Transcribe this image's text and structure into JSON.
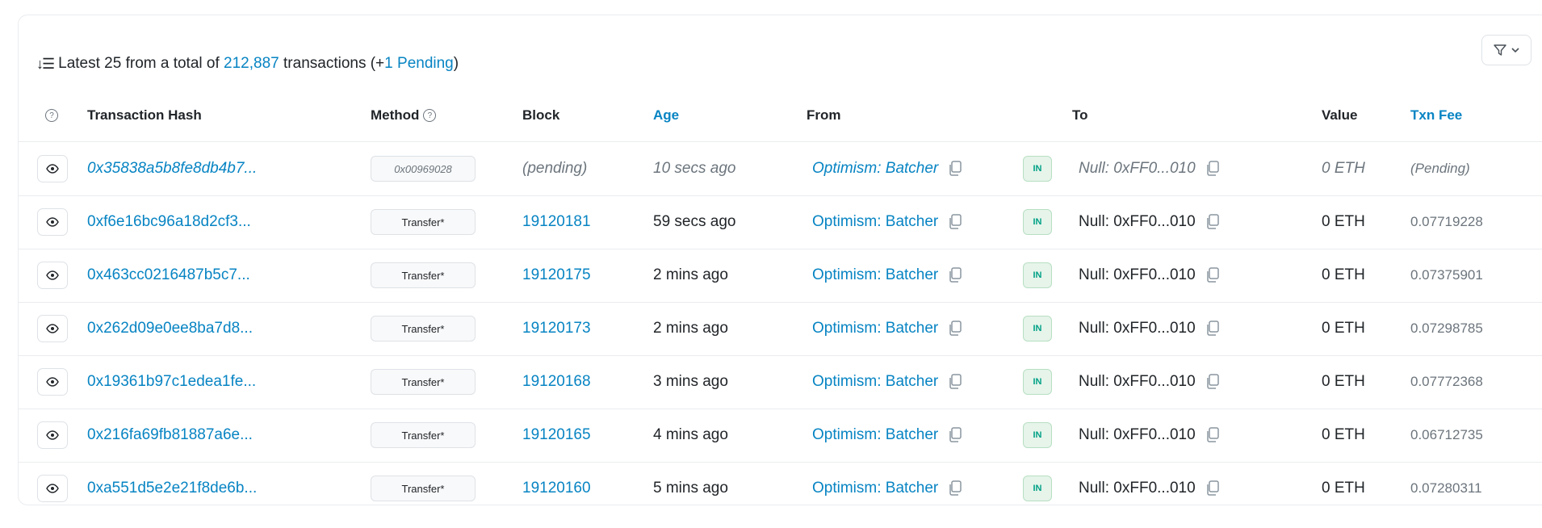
{
  "summary": {
    "prefix": "Latest 25 from a total of",
    "total": "212,887",
    "middle": "transactions (+",
    "pending": "1 Pending",
    "suffix": ")"
  },
  "headers": {
    "hash": "Transaction Hash",
    "method": "Method",
    "block": "Block",
    "age": "Age",
    "from": "From",
    "to": "To",
    "value": "Value",
    "fee": "Txn Fee"
  },
  "colors": {
    "link": "#0784c3",
    "in_badge": "#00a186"
  },
  "rows": [
    {
      "hash": "0x35838a5b8fe8db4b7...",
      "method": "0x00969028",
      "block": "(pending)",
      "age": "10 secs ago",
      "from": "Optimism: Batcher",
      "direction": "IN",
      "to": "Null: 0xFF0...010",
      "value": "0 ETH",
      "fee": "(Pending)"
    },
    {
      "hash": "0xf6e16bc96a18d2cf3...",
      "method": "Transfer*",
      "block": "19120181",
      "age": "59 secs ago",
      "from": "Optimism: Batcher",
      "direction": "IN",
      "to": "Null: 0xFF0...010",
      "value": "0 ETH",
      "fee": "0.07719228"
    },
    {
      "hash": "0x463cc0216487b5c7...",
      "method": "Transfer*",
      "block": "19120175",
      "age": "2 mins ago",
      "from": "Optimism: Batcher",
      "direction": "IN",
      "to": "Null: 0xFF0...010",
      "value": "0 ETH",
      "fee": "0.07375901"
    },
    {
      "hash": "0x262d09e0ee8ba7d8...",
      "method": "Transfer*",
      "block": "19120173",
      "age": "2 mins ago",
      "from": "Optimism: Batcher",
      "direction": "IN",
      "to": "Null: 0xFF0...010",
      "value": "0 ETH",
      "fee": "0.07298785"
    },
    {
      "hash": "0x19361b97c1edea1fe...",
      "method": "Transfer*",
      "block": "19120168",
      "age": "3 mins ago",
      "from": "Optimism: Batcher",
      "direction": "IN",
      "to": "Null: 0xFF0...010",
      "value": "0 ETH",
      "fee": "0.07772368"
    },
    {
      "hash": "0x216fa69fb81887a6e...",
      "method": "Transfer*",
      "block": "19120165",
      "age": "4 mins ago",
      "from": "Optimism: Batcher",
      "direction": "IN",
      "to": "Null: 0xFF0...010",
      "value": "0 ETH",
      "fee": "0.06712735"
    },
    {
      "hash": "0xa551d5e2e21f8de6b...",
      "method": "Transfer*",
      "block": "19120160",
      "age": "5 mins ago",
      "from": "Optimism: Batcher",
      "direction": "IN",
      "to": "Null: 0xFF0...010",
      "value": "0 ETH",
      "fee": "0.07280311"
    }
  ]
}
